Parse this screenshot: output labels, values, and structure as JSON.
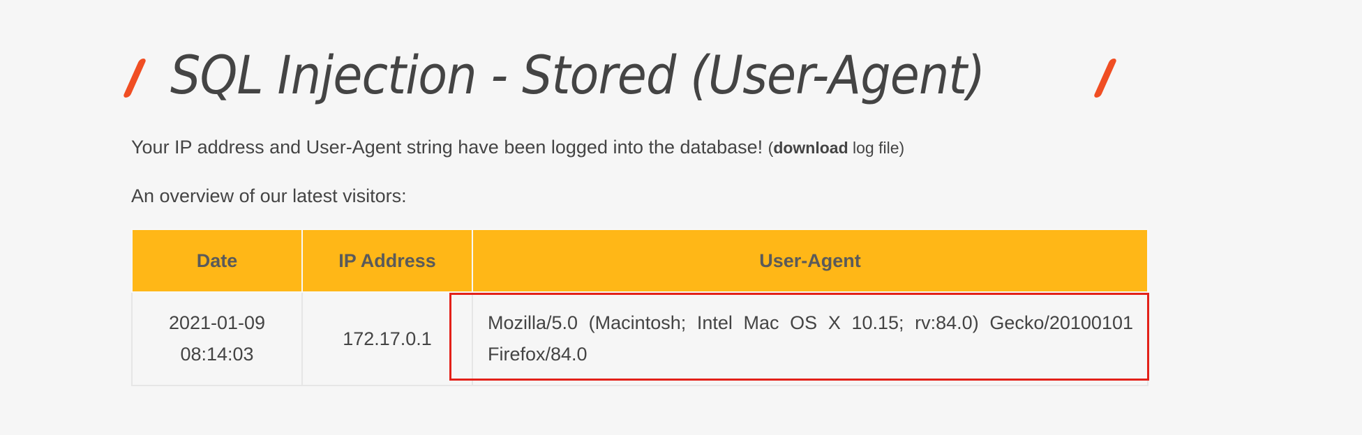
{
  "header": {
    "title": "SQL Injection - Stored (User-Agent)"
  },
  "intro": {
    "text": "Your IP address and User-Agent string have been logged into the database! ",
    "paren_open": "(",
    "link_label": "download",
    "link_suffix": " log file",
    "paren_close": ")"
  },
  "overview": {
    "text": "An overview of our latest visitors:"
  },
  "table": {
    "headers": [
      "Date",
      "IP Address",
      "User-Agent"
    ],
    "rows": [
      {
        "date_line1": "2021-01-09",
        "date_line2": "08:14:03",
        "ip": "172.17.0.1",
        "user_agent": "Mozilla/5.0 (Macintosh; Intel Mac OS X 10.15; rv:84.0) Gecko/20100101 Firefox/84.0"
      }
    ]
  },
  "colors": {
    "accent_slash": "#f04e23",
    "table_header_bg": "#ffb717",
    "highlight_border": "#e32119",
    "text": "#444444"
  }
}
